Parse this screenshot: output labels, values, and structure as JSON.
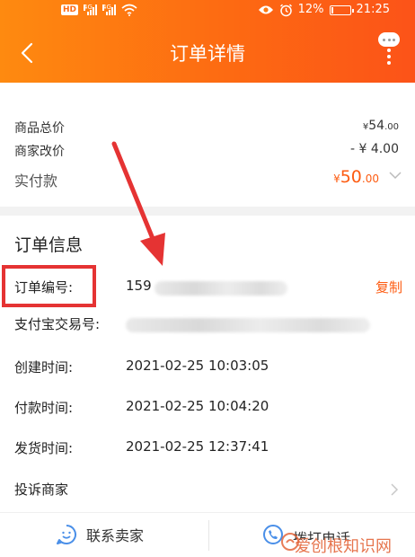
{
  "status_bar": {
    "network_labels": [
      "HD",
      "4G",
      "4G"
    ],
    "battery": "12%",
    "time": "21:25",
    "battery_level": 0.12
  },
  "header": {
    "title": "订单详情"
  },
  "price": {
    "total_label": "商品总价",
    "total_prefix": "¥",
    "total_int": "54",
    "total_dec": ".00",
    "adjust_label": "商家改价",
    "adjust_value": "- ¥ 4.00",
    "paid_label": "实付款",
    "paid_prefix": "¥",
    "paid_int": "50",
    "paid_dec": ".00"
  },
  "order_info": {
    "title": "订单信息",
    "order_no_label": "订单编号:",
    "order_no_value": "159",
    "copy_label": "复制",
    "alipay_label": "支付宝交易号:",
    "created_label": "创建时间:",
    "created_value": "2021-02-25 10:03:05",
    "paid_time_label": "付款时间:",
    "paid_time_value": "2021-02-25 10:04:20",
    "shipped_label": "发货时间:",
    "shipped_value": "2021-02-25 12:37:41",
    "complaint_label": "投诉商家"
  },
  "bottom_bar": {
    "contact_seller": "联系卖家",
    "call_partial": "拨打电话"
  },
  "watermark": {
    "text": "爱创根知识网"
  },
  "colors": {
    "header_gradient_start": "#fe8a10",
    "header_gradient_end": "#fc5318",
    "accent_orange": "#fd5c12",
    "highlight_red": "#e53333",
    "icon_blue": "#4a8fe8"
  },
  "icons": {
    "back": "chevron-left-icon",
    "more": "more-vertical-icon",
    "expand": "chevron-down-icon",
    "complaint": "chevron-right-icon",
    "contact": "chat-smile-icon",
    "call": "phone-icon"
  }
}
